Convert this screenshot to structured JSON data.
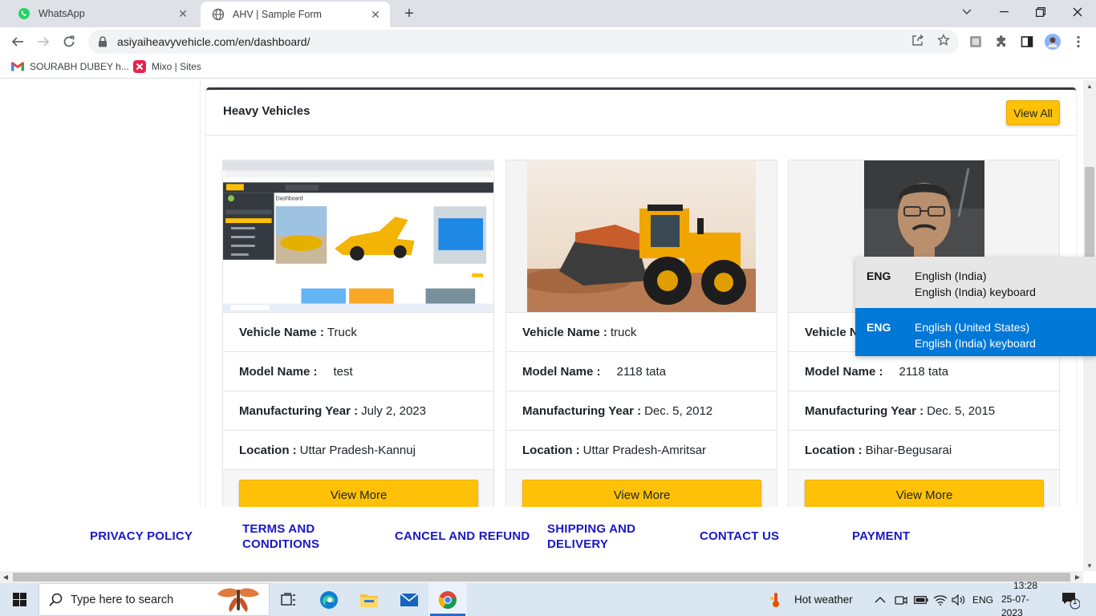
{
  "browser": {
    "tabs": [
      {
        "title": "WhatsApp",
        "icon": "whatsapp-icon"
      },
      {
        "title": "AHV | Sample Form",
        "icon": "globe-icon"
      }
    ],
    "url": "asiyaiheavyvehicle.com/en/dashboard/",
    "bookmarks": [
      {
        "label": "SOURABH DUBEY h...",
        "icon": "gmail-icon"
      },
      {
        "label": "Mixo | Sites",
        "icon": "mixo-icon"
      }
    ]
  },
  "section": {
    "title": "Heavy Vehicles",
    "view_all": "View All"
  },
  "labels": {
    "vehicle_name": "Vehicle Name :",
    "model_name": "Model Name :",
    "manufacturing_year": "Manufacturing Year :",
    "location": "Location :",
    "view_more": "View More"
  },
  "vehicles": [
    {
      "image": "dashboard screenshot",
      "vehicle_name": "Truck",
      "model_name": "test",
      "manufacturing_year": "July 2, 2023",
      "location": "Uttar Pradesh-Kannuj"
    },
    {
      "image": "wheel loader",
      "vehicle_name": "truck",
      "model_name": "2118 tata",
      "manufacturing_year": "Dec. 5, 2012",
      "location": "Uttar Pradesh-Amritsar"
    },
    {
      "image": "portrait photo",
      "vehicle_name": "",
      "model_name": "2118 tata",
      "manufacturing_year": "Dec. 5, 2015",
      "location": "Bihar-Begusarai"
    }
  ],
  "footer": {
    "links": [
      "PRIVACY POLICY",
      "TERMS AND CONDITIONS",
      "CANCEL AND REFUND",
      "SHIPPING AND DELIVERY",
      "CONTACT US",
      "PAYMENT"
    ]
  },
  "language_popup": {
    "options": [
      {
        "code": "ENG",
        "language": "English (India)",
        "keyboard": "English (India) keyboard",
        "selected": false
      },
      {
        "code": "ENG",
        "language": "English (United States)",
        "keyboard": "English (India) keyboard",
        "selected": true
      }
    ]
  },
  "taskbar": {
    "search_placeholder": "Type here to search",
    "weather": "Hot weather",
    "lang": "ENG",
    "time": "13:28",
    "date": "25-07-2023",
    "notification_count": "1"
  },
  "colors": {
    "accent_yellow": "#ffc107",
    "link_blue": "#1a17c7",
    "selection_blue": "#0078d7",
    "header_dark": "#343a40"
  }
}
